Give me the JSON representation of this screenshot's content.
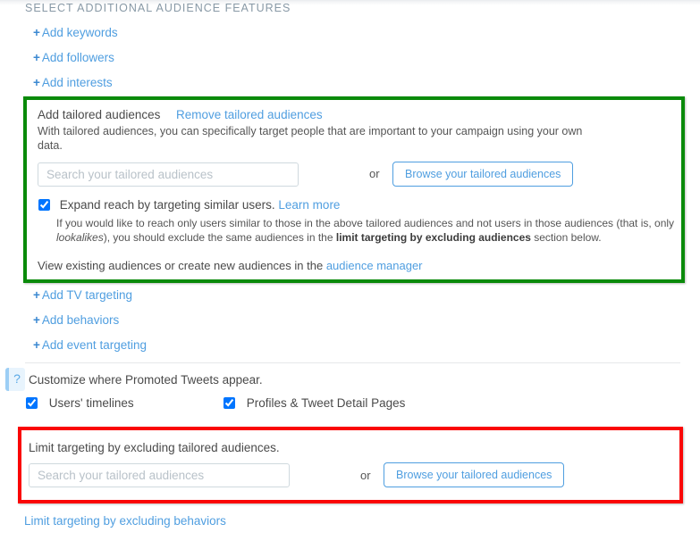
{
  "section": {
    "heading": "SELECT ADDITIONAL AUDIENCE FEATURES"
  },
  "add_links_top": [
    {
      "plus": "+",
      "label": "Add keywords"
    },
    {
      "plus": "+",
      "label": "Add followers"
    },
    {
      "plus": "+",
      "label": "Add interests"
    }
  ],
  "tailored_audiences": {
    "title": "Add tailored audiences",
    "remove_link": "Remove tailored audiences",
    "description": "With tailored audiences, you can specifically target people that are important to your campaign using your own data.",
    "search": {
      "value": "",
      "placeholder": "Search your tailored audiences"
    },
    "or_label": "or",
    "browse_button": "Browse your tailored audiences",
    "expand": {
      "checked": true,
      "label": "Expand reach by targeting similar users.",
      "learn_more": "Learn more",
      "note_part1": "If you would like to reach only users similar to those in the above tailored audiences and not users in those audiences (that is, only ",
      "note_italic": "lookalikes",
      "note_part2": "), you should exclude the same audiences in the ",
      "note_bold": "limit targeting by excluding audiences",
      "note_part3": " section below."
    },
    "footer_text": "View existing audiences or create new audiences in the",
    "footer_link": "audience manager",
    "highlight_color": "#0a8a0a"
  },
  "add_links_bottom": [
    {
      "plus": "+",
      "label": "Add TV targeting"
    },
    {
      "plus": "+",
      "label": "Add behaviors"
    },
    {
      "plus": "+",
      "label": "Add event targeting"
    }
  ],
  "placements": {
    "help_icon": "?",
    "label": "Customize where Promoted Tweets appear.",
    "options": [
      {
        "label": "Users' timelines",
        "checked": true
      },
      {
        "label": "Profiles & Tweet Detail Pages",
        "checked": true
      }
    ]
  },
  "limit_targeting": {
    "label": "Limit targeting by excluding tailored audiences.",
    "search": {
      "value": "",
      "placeholder": "Search your tailored audiences"
    },
    "or_label": "or",
    "browse_button": "Browse your tailored audiences",
    "highlight_color": "#fa0505"
  },
  "bottom_link": "Limit targeting by excluding behaviors"
}
